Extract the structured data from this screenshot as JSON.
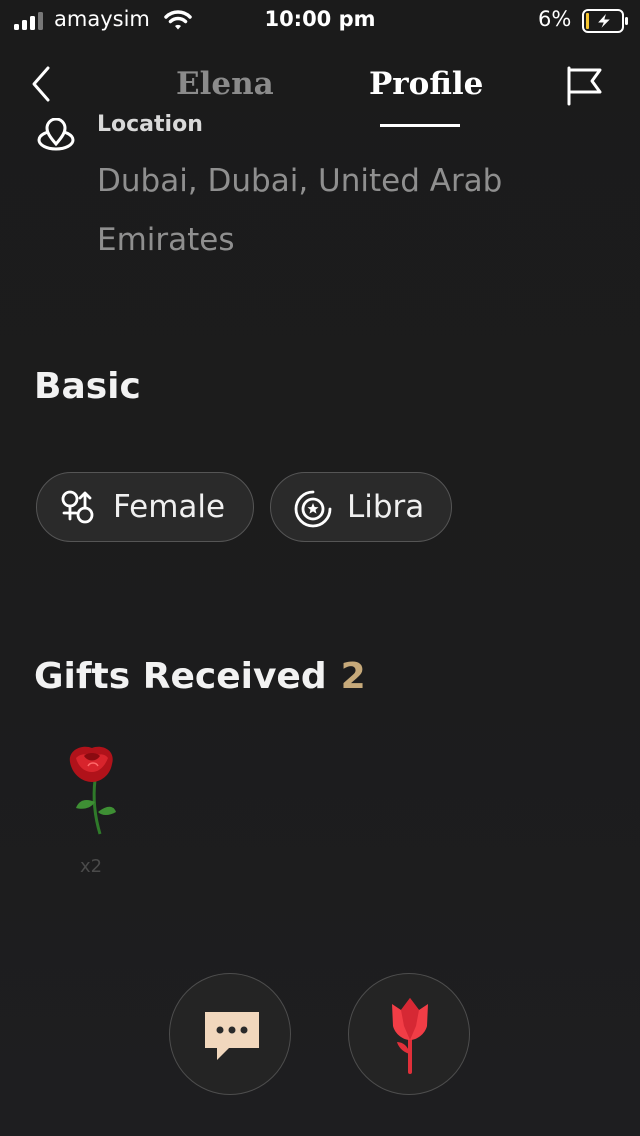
{
  "status_bar": {
    "carrier": "amaysim",
    "time": "10:00 pm",
    "battery_percent": "6%"
  },
  "nav": {
    "tabs": [
      {
        "label": "Elena",
        "active": false
      },
      {
        "label": "Profile",
        "active": true
      }
    ]
  },
  "location": {
    "label": "Location",
    "value": "Dubai, Dubai, United Arab Emirates"
  },
  "basic": {
    "heading": "Basic",
    "chips": [
      {
        "label": "Female",
        "icon": "gender-icon"
      },
      {
        "label": "Libra",
        "icon": "zodiac-icon"
      }
    ]
  },
  "gifts": {
    "heading": "Gifts Received",
    "count": "2",
    "items": [
      {
        "icon": "rose-gift-icon",
        "quantity": "x2"
      }
    ]
  },
  "actions": [
    {
      "icon": "chat-icon"
    },
    {
      "icon": "rose-icon"
    }
  ],
  "colors": {
    "background": "#1b1b1b",
    "accent_gold": "#c6a97a",
    "chip_bg": "#2a2a2a",
    "muted_text": "#8f8f8f"
  }
}
